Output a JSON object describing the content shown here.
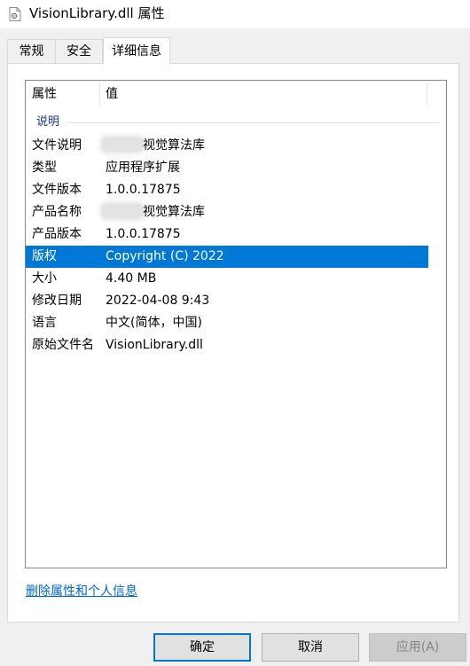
{
  "window": {
    "title": "VisionLibrary.dll 属性",
    "icon": "dll-file-icon"
  },
  "tabs": [
    {
      "label": "常规",
      "active": false
    },
    {
      "label": "安全",
      "active": false
    },
    {
      "label": "详细信息",
      "active": true
    }
  ],
  "details": {
    "columns": {
      "property": "属性",
      "value": "值"
    },
    "group": "说明",
    "rows": [
      {
        "key": "文件说明",
        "value": "视觉算法库",
        "redacted_prefix": true
      },
      {
        "key": "类型",
        "value": "应用程序扩展"
      },
      {
        "key": "文件版本",
        "value": "1.0.0.17875"
      },
      {
        "key": "产品名称",
        "value": "视觉算法库",
        "redacted_prefix": true
      },
      {
        "key": "产品版本",
        "value": "1.0.0.17875"
      },
      {
        "key": "版权",
        "value": "Copyright (C) 2022",
        "selected": true
      },
      {
        "key": "大小",
        "value": "4.40 MB"
      },
      {
        "key": "修改日期",
        "value": "2022-04-08 9:43"
      },
      {
        "key": "语言",
        "value": "中文(简体，中国)"
      },
      {
        "key": "原始文件名",
        "value": "VisionLibrary.dll"
      }
    ]
  },
  "link": "删除属性和个人信息",
  "buttons": {
    "ok": "确定",
    "cancel": "取消",
    "apply": "应用(A)"
  },
  "colors": {
    "selection": "#0078d7",
    "link": "#0066cc",
    "group": "#1e3287"
  }
}
